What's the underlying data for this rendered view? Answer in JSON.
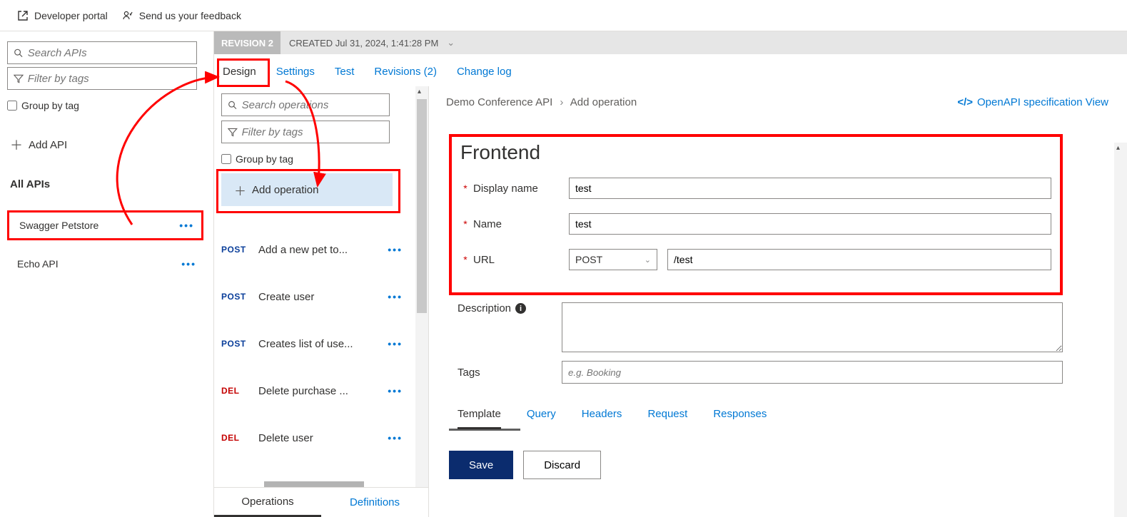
{
  "topbar": {
    "dev_portal": "Developer portal",
    "feedback": "Send us your feedback"
  },
  "sidebar": {
    "search_placeholder": "Search APIs",
    "filter_placeholder": "Filter by tags",
    "group_by_tag": "Group by tag",
    "add_api": "Add API",
    "all_apis": "All APIs",
    "apis": [
      {
        "name": "Swagger Petstore"
      },
      {
        "name": "Echo API"
      }
    ]
  },
  "revision": {
    "label": "REVISION 2",
    "created": "CREATED Jul 31, 2024, 1:41:28 PM"
  },
  "tabs": {
    "design": "Design",
    "settings": "Settings",
    "test": "Test",
    "revisions": "Revisions (2)",
    "changelog": "Change log"
  },
  "ops": {
    "search_placeholder": "Search operations",
    "filter_placeholder": "Filter by tags",
    "group_by_tag": "Group by tag",
    "add_operation": "Add operation",
    "list": [
      {
        "method": "POST",
        "method_class": "post",
        "name": "Add a new pet to..."
      },
      {
        "method": "POST",
        "method_class": "post",
        "name": "Create user"
      },
      {
        "method": "POST",
        "method_class": "post",
        "name": "Creates list of use..."
      },
      {
        "method": "DEL",
        "method_class": "del",
        "name": "Delete purchase ..."
      },
      {
        "method": "DEL",
        "method_class": "del",
        "name": "Delete user"
      }
    ],
    "bottom_tabs": {
      "operations": "Operations",
      "definitions": "Definitions"
    }
  },
  "detail": {
    "breadcrumb_api": "Demo Conference API",
    "breadcrumb_op": "Add operation",
    "openapi_link": "OpenAPI specification View",
    "frontend_heading": "Frontend",
    "fields": {
      "display_name_label": "Display name",
      "display_name_value": "test",
      "name_label": "Name",
      "name_value": "test",
      "url_label": "URL",
      "url_method": "POST",
      "url_value": "/test",
      "description_label": "Description",
      "tags_label": "Tags",
      "tags_placeholder": "e.g. Booking"
    },
    "sub_tabs": {
      "template": "Template",
      "query": "Query",
      "headers": "Headers",
      "request": "Request",
      "responses": "Responses"
    },
    "buttons": {
      "save": "Save",
      "discard": "Discard"
    }
  }
}
